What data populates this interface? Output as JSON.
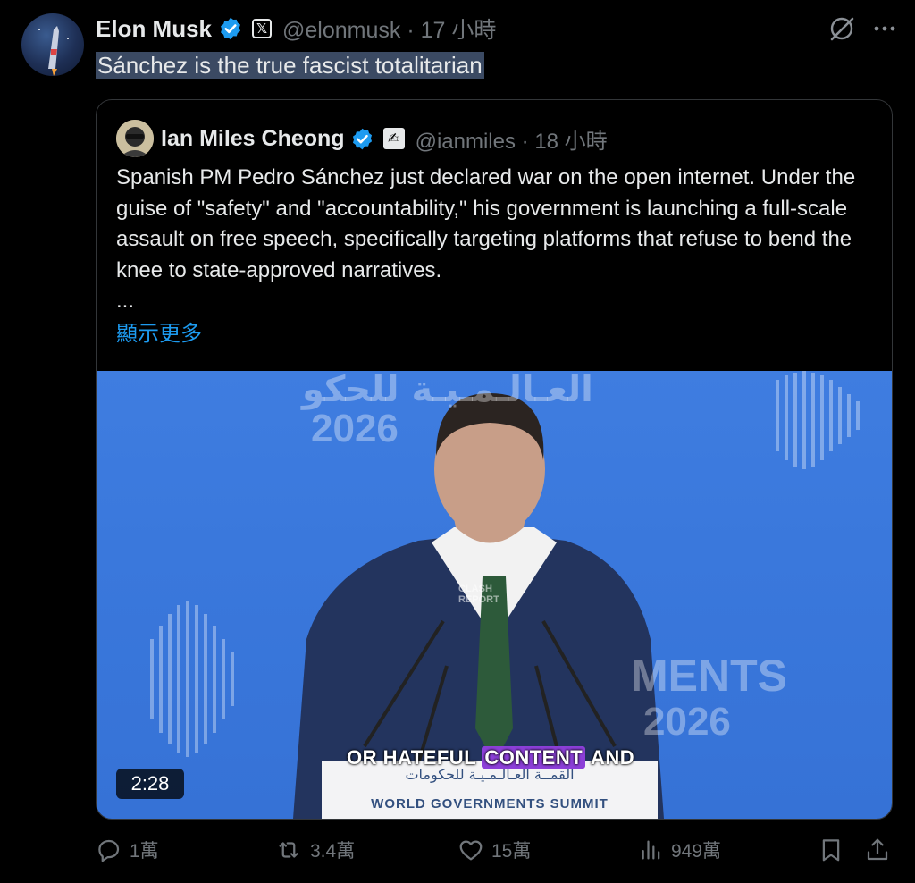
{
  "post": {
    "author_name": "Elon Musk",
    "x_badge": "𝕏",
    "handle_time": "@elonmusk · 17 小時",
    "text": "Sánchez is the true fascist totalitarian"
  },
  "quoted": {
    "author_name": "Ian Miles Cheong",
    "badge": "✍",
    "handle_time": "@ianmiles · 18 小時",
    "body": "Spanish PM Pedro Sánchez just declared war on the open internet. Under the guise of \"safety\" and \"accountability,\" his government is launching a full-scale assault on free speech, specifically targeting platforms that refuse to bend the knee to state-approved narratives.",
    "ellipsis": "...",
    "show_more": "顯示更多",
    "video": {
      "duration": "2:28",
      "caption_before": "OR HATEFUL ",
      "caption_highlight": "CONTENT",
      "caption_after": " AND",
      "podium_arabic": "القمــة العـالـمـيـة للحكومات",
      "podium_english": "WORLD GOVERNMENTS SUMMIT",
      "backdrop_year_left": "2026",
      "backdrop_word_right": "MENTS",
      "backdrop_year_right": "2026",
      "backdrop_arabic": "العـالـمـيـة للحكو",
      "watermark_top": "CLASH",
      "watermark_bottom": "REPORT"
    }
  },
  "actions": {
    "replies": "1萬",
    "reposts": "3.4萬",
    "likes": "15萬",
    "views": "949萬"
  },
  "colors": {
    "background": "#000000",
    "text": "#e7e9ea",
    "muted": "#71767b",
    "link": "#1d9bf0",
    "verified": "#1d9bf0",
    "selection": "#3b4a63"
  }
}
